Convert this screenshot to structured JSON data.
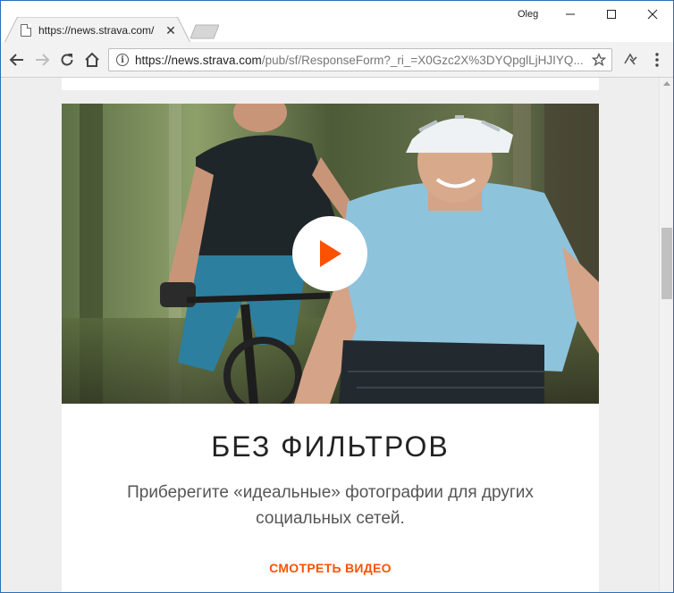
{
  "window": {
    "profile_name": "Oleg",
    "controls": {
      "minimize": "minimize-icon",
      "maximize": "maximize-icon",
      "close": "close-icon"
    }
  },
  "tab": {
    "title": "https://news.strava.com/pub/sf/ResponseForm",
    "favicon": "document-icon",
    "close_icon": "close-icon"
  },
  "toolbar": {
    "back_icon": "back-arrow-icon",
    "forward_icon": "forward-arrow-icon",
    "reload_icon": "reload-icon",
    "home_icon": "home-icon",
    "url_host": "https://news.strava.com",
    "url_path": "/pub/sf/ResponseForm?_ri_=X0Gzc2X%3DYQpglLjHJIYQ...",
    "bookmark_icon": "star-icon",
    "extension_icon": "strava-extension-icon",
    "menu_icon": "more-vertical-icon"
  },
  "content": {
    "headline": "БЕЗ ФИЛЬТРОВ",
    "subtext": "Приберегите «идеальные» фотографии для других социальных сетей.",
    "cta": "СМОТРЕТЬ ВИДЕО",
    "play_icon": "play-icon",
    "colors": {
      "accent": "#fc5200",
      "heading": "#222222",
      "body": "#555555",
      "page_bg": "#eeeeee"
    }
  }
}
